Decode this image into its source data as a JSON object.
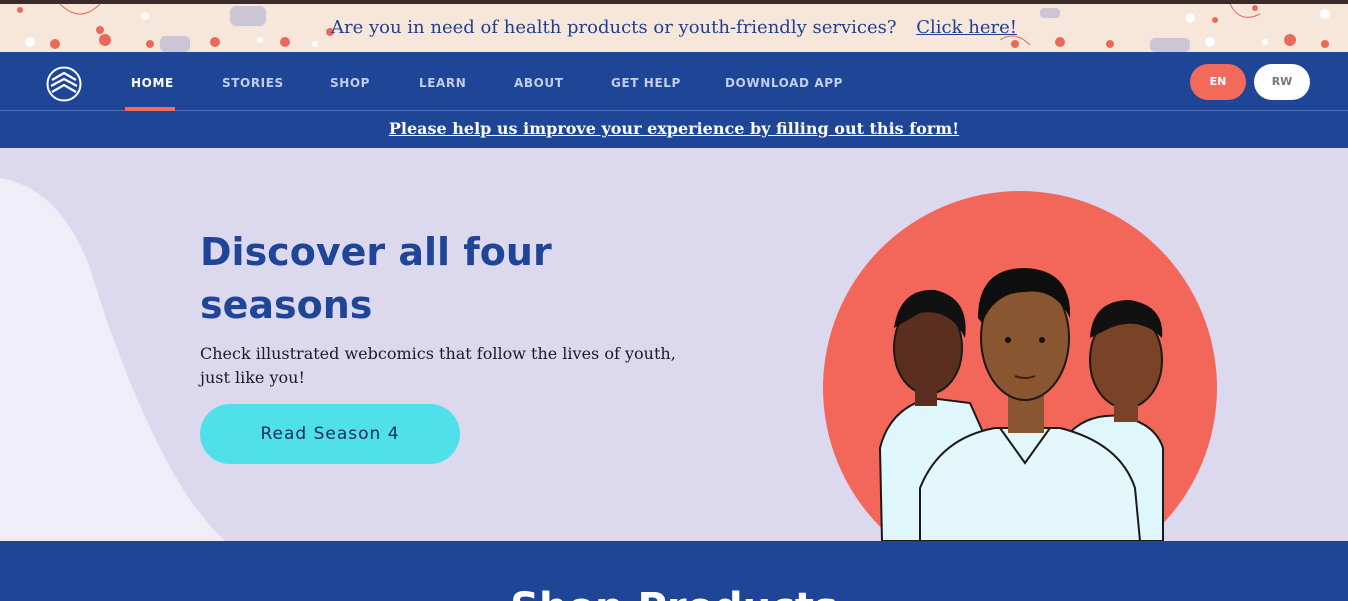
{
  "announcement": {
    "text": "Are you in need of health products or youth-friendly services?",
    "link_label": "Click here!"
  },
  "nav": {
    "logo_icon": "logo-chevrons-icon",
    "items": [
      {
        "label": "HOME",
        "active": true
      },
      {
        "label": "STORIES"
      },
      {
        "label": "SHOP"
      },
      {
        "label": "LEARN"
      },
      {
        "label": "ABOUT"
      },
      {
        "label": "GET HELP"
      },
      {
        "label": "DOWNLOAD APP"
      }
    ],
    "languages": [
      "EN",
      "RW"
    ]
  },
  "feedback": {
    "link_label": "Please help us improve your experience by filling out this form!"
  },
  "hero": {
    "title": "Discover all four seasons",
    "description": "Check illustrated webcomics that follow the lives of youth, just like you!",
    "cta_label": "Read Season 4"
  },
  "bottom": {
    "heading": "Shop Products"
  },
  "colors": {
    "primary_blue": "#1f4596",
    "coral": "#f26a5a",
    "cyan": "#4fe0ea",
    "lavender": "#dcd8ee",
    "cream": "#f6e7da"
  }
}
